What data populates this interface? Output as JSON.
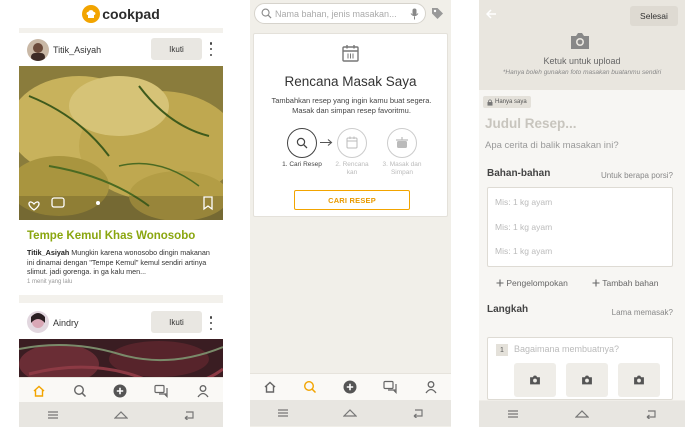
{
  "feed": {
    "brand": "cookpad",
    "post1": {
      "username": "Titik_Asiyah",
      "follow_label": "Ikuti",
      "title": "Tempe Kemul Khas Wonosobo",
      "author": "Titik_Asiyah",
      "description": "Mungkin karena wonosobo dingin makanan ini dinamai dengan \"Tempe Kemul\" kemul sendiri artinya slimut. jadi gorenga. in ga kalu men...",
      "time": "1 menit yang lalu"
    },
    "post2": {
      "username": "Aindry",
      "follow_label": "Ikuti"
    },
    "nav": [
      "home-icon",
      "search-icon",
      "add-icon",
      "chat-icon",
      "profile-icon"
    ]
  },
  "planner": {
    "search_placeholder": "Nama bahan, jenis masakan...",
    "title": "Rencana Masak Saya",
    "description": "Tambahkan resep yang ingin kamu buat segera. Masak dan simpan resep favoritmu.",
    "steps": [
      {
        "label": "1. Cari Resep"
      },
      {
        "label": "2. Rencana kan"
      },
      {
        "label": "3. Masak dan Simpan"
      }
    ],
    "button": "CARI RESEP"
  },
  "editor": {
    "done_label": "Selesai",
    "upload_label": "Ketuk untuk upload",
    "upload_note": "*Hanya boleh gunakan foto masakan buatanmu sendiri",
    "privacy_badge": "Hanya saya",
    "title_placeholder": "Judul Resep...",
    "story_placeholder": "Apa cerita di balik masakan ini?",
    "ingredients_header": "Bahan-bahan",
    "servings_label": "Untuk berapa porsi?",
    "ingredients": [
      "Mis: 1 kg ayam",
      "Mis: 1 kg ayam",
      "Mis: 1 kg ayam"
    ],
    "group_label": "Pengelompokan",
    "add_ingredient_label": "Tambah bahan",
    "steps_header": "Langkah",
    "duration_label": "Lama memasak?",
    "step_number": "1",
    "step_placeholder": "Bagaimana membuatnya?"
  },
  "colors": {
    "accent": "#f2a400",
    "title_green": "#8aa60f"
  }
}
